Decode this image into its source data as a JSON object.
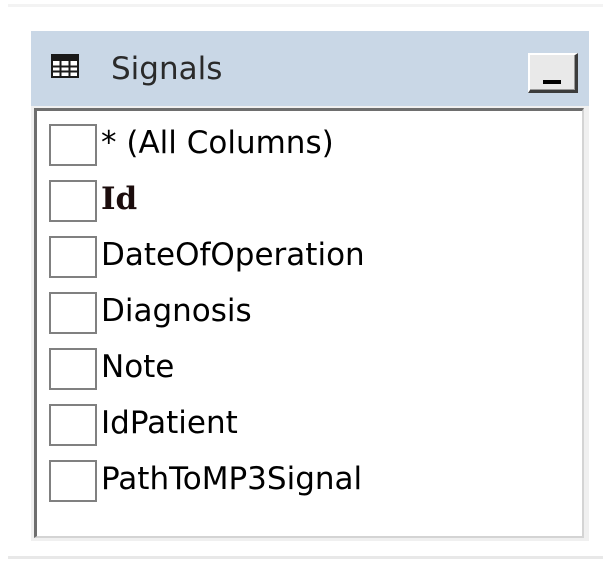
{
  "window": {
    "title": "Signals",
    "title_icon": "table-grid-icon",
    "minimize_label": "_"
  },
  "columns": [
    {
      "label": "* (All Columns)",
      "checked": false,
      "primary_key": false
    },
    {
      "label": "Id",
      "checked": false,
      "primary_key": true
    },
    {
      "label": "DateOfOperation",
      "checked": false,
      "primary_key": false
    },
    {
      "label": "Diagnosis",
      "checked": false,
      "primary_key": false
    },
    {
      "label": "Note",
      "checked": false,
      "primary_key": false
    },
    {
      "label": "IdPatient",
      "checked": false,
      "primary_key": false
    },
    {
      "label": "PathToMP3Signal",
      "checked": false,
      "primary_key": false
    }
  ],
  "colors": {
    "title_bar": "#c9d7e6",
    "panel_background": "#f0f0f0",
    "list_background": "#ffffff"
  }
}
